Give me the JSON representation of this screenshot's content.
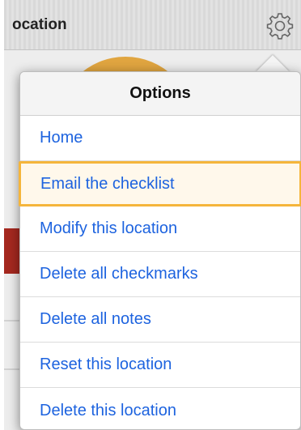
{
  "topbar": {
    "title": "ocation",
    "settings_icon": "gear-icon"
  },
  "popover": {
    "title": "Options",
    "items": [
      {
        "label": "Home",
        "selected": false
      },
      {
        "label": "Email the checklist",
        "selected": true
      },
      {
        "label": "Modify this location",
        "selected": false
      },
      {
        "label": "Delete all checkmarks",
        "selected": false
      },
      {
        "label": "Delete all notes",
        "selected": false
      },
      {
        "label": "Reset this location",
        "selected": false
      },
      {
        "label": "Delete this location",
        "selected": false
      }
    ]
  },
  "colors": {
    "link": "#1d63df",
    "highlight_border": "#f5b53b",
    "highlight_fill": "#fff8eb",
    "banner": "#a5281f",
    "badge": "#e0a540"
  }
}
